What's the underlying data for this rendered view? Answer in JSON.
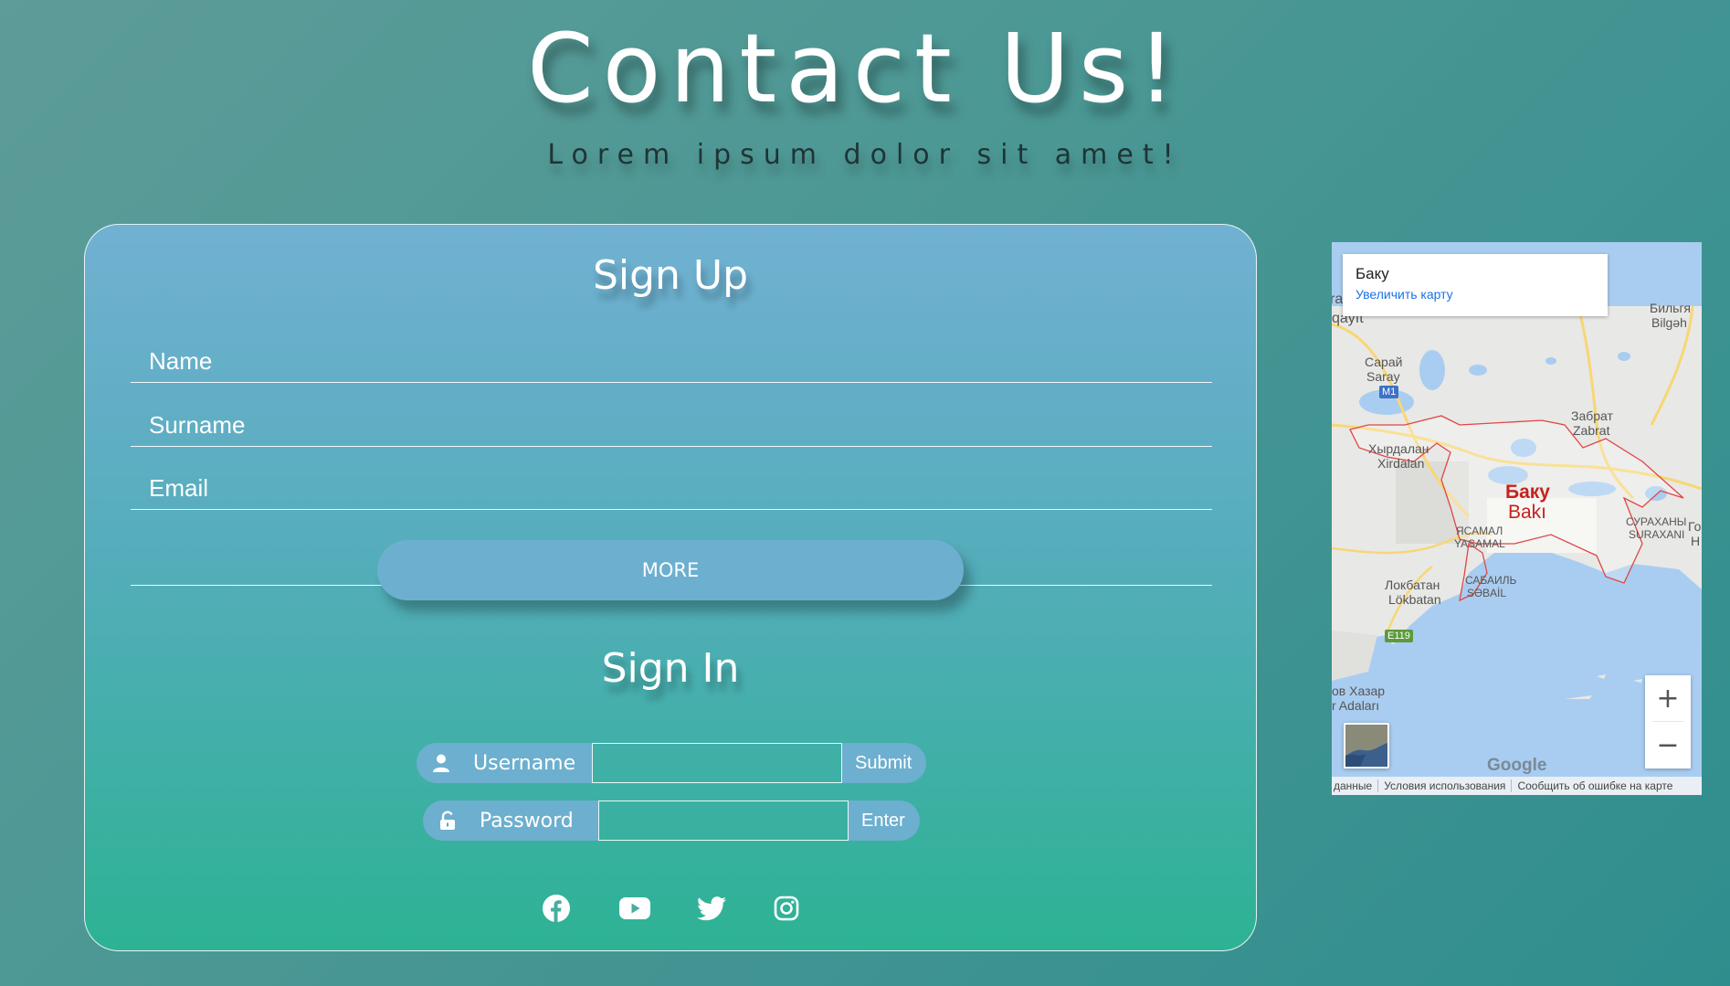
{
  "hero": {
    "title": "Contact Us!",
    "subtitle": "Lorem ipsum dolor sit amet!"
  },
  "signup": {
    "title": "Sign Up",
    "name_placeholder": "Name",
    "surname_placeholder": "Surname",
    "email_placeholder": "Email",
    "more_label": "MORE"
  },
  "signin": {
    "title": "Sign In",
    "username_label": "Username",
    "username_value": "",
    "submit_label": "Submit",
    "password_label": "Password",
    "password_value": "",
    "enter_label": "Enter"
  },
  "social": {
    "icons": [
      "facebook-icon",
      "youtube-icon",
      "twitter-icon",
      "instagram-icon"
    ]
  },
  "map": {
    "info_place": "Баку",
    "info_link": "Увеличить карту",
    "labels": {
      "sumqayit": "qayıt",
      "bilgah_ru": "Бильгя",
      "bilgah_az": "Bilgəh",
      "saray_ru": "Сарай",
      "saray_az": "Saray",
      "zabrat_ru": "Забрат",
      "zabrat_az": "Zabrat",
      "xirdalan_ru": "Хырдалан",
      "xirdalan_az": "Xirdalan",
      "baku_ru": "Баку",
      "baku_az": "Bakı",
      "yasamal_ru": "ЯСАМАЛ",
      "yasamal_az": "YASAMAL",
      "suraxani_ru": "СУРАХАНЫ",
      "suraxani_az": "SURAXANI",
      "lokbatan_ru": "Локбатан",
      "lokbatan_az": "Lökbatan",
      "sabail_ru": "САБАИЛЬ",
      "sabail_az": "SƏBAİL",
      "xazar_ru": "ов Хазар",
      "xazar_az": "r Adaları",
      "m1": "M1",
      "e119": "E119",
      "edge_ra": "ra",
      "edge_go": "Го",
      "edge_h": "H"
    },
    "zoom_in": "+",
    "zoom_out": "−",
    "google": "Google",
    "footer": [
      "данные",
      "Условия использования",
      "Сообщить об ошибке на карте"
    ],
    "colors": {
      "water": "#a9cdf0",
      "land": "#e8e8e6",
      "boundary": "#e04646",
      "road": "#f7d774"
    }
  }
}
